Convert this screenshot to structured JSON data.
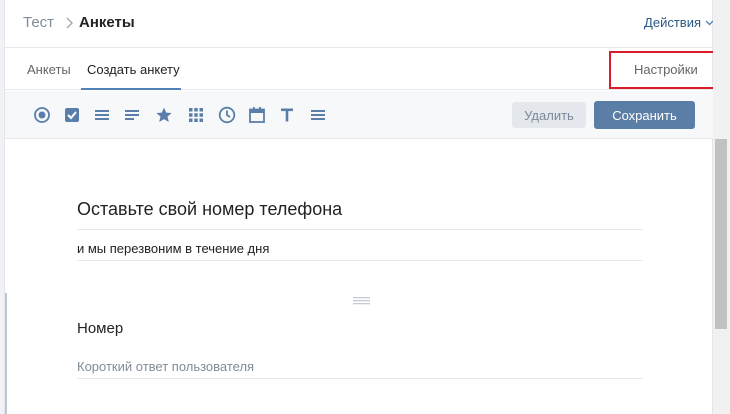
{
  "header": {
    "breadcrumb_parent": "Тест",
    "breadcrumb_current": "Анкеты",
    "actions_label": "Действия"
  },
  "tabs": [
    {
      "label": "Анкеты",
      "active": false
    },
    {
      "label": "Создать анкету",
      "active": true
    }
  ],
  "settings_label": "Настройки",
  "toolbar": {
    "tools": [
      "radio-icon",
      "checkbox-icon",
      "paragraph-icon",
      "short-text-icon",
      "star-rating-icon",
      "grid-icon",
      "clock-icon",
      "calendar-icon",
      "text-title-icon",
      "divider-icon"
    ],
    "delete_label": "Удалить",
    "save_label": "Сохранить"
  },
  "form": {
    "title": "Оставьте свой номер телефона",
    "description": "и мы перезвоним в течение дня",
    "question_title": "Номер",
    "answer_placeholder": "Короткий ответ пользователя"
  },
  "colors": {
    "accent": "#5181b8",
    "save_button": "#5b7ea6",
    "highlight_box": "#d91b2a",
    "icon": "#5a7ea8"
  }
}
